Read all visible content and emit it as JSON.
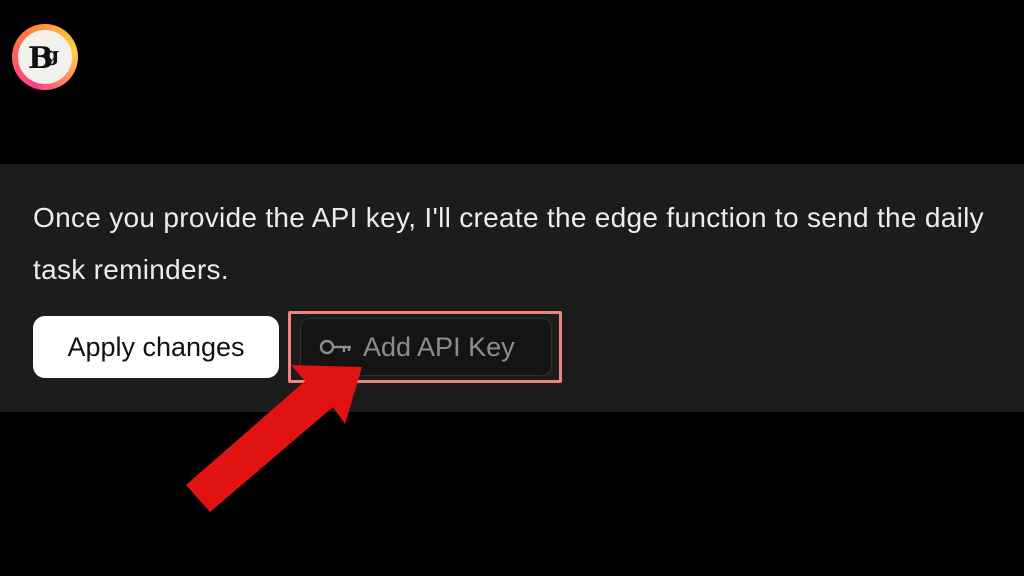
{
  "logo": {
    "icon": "bg-logo-icon",
    "ring_colors": [
      "#ff3d8b",
      "#ff7a3d",
      "#ffd23d"
    ]
  },
  "message": {
    "text": "Once you provide the API key, I'll create the edge function to send the daily task reminders."
  },
  "actions": {
    "apply_label": "Apply changes",
    "add_api_key_label": "Add API Key",
    "add_api_key_icon": "key-icon"
  },
  "annotation": {
    "highlight_color": "#f0837a",
    "arrow_color": "#e01212"
  },
  "colors": {
    "background": "#000000",
    "panel": "#1c1c1c",
    "text": "#ececec"
  }
}
